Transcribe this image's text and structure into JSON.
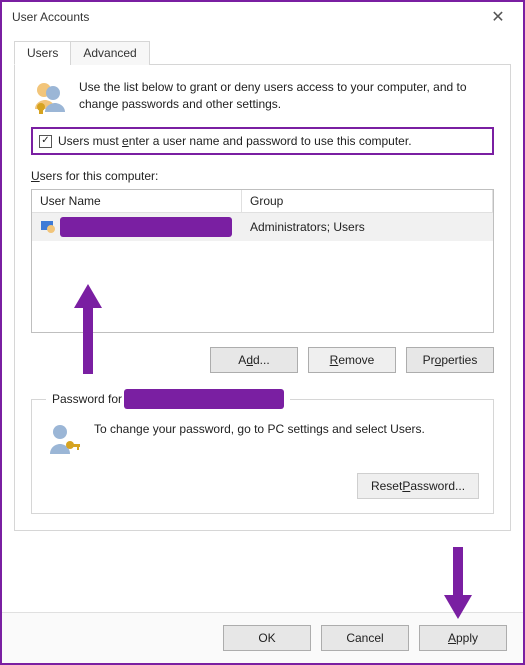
{
  "window": {
    "title": "User Accounts"
  },
  "tabs": {
    "users": "Users",
    "advanced": "Advanced"
  },
  "intro": "Use the list below to grant or deny users access to your computer, and to change passwords and other settings.",
  "checkbox_label_pre": "Users must ",
  "checkbox_label_u": "e",
  "checkbox_label_post": "nter a user name and password to use this computer.",
  "users_label_pre": "",
  "users_label_u": "U",
  "users_label_post": "sers for this computer:",
  "columns": {
    "name": "User Name",
    "group": "Group"
  },
  "row": {
    "group": "Administrators; Users"
  },
  "buttons": {
    "add_pre": "A",
    "add_u": "d",
    "add_post": "d...",
    "remove_pre": "",
    "remove_u": "R",
    "remove_post": "emove",
    "properties_pre": "Pr",
    "properties_u": "o",
    "properties_post": "perties"
  },
  "fieldset_legend": "Password for ",
  "pwd_text": "To change your password, go to PC settings and select Users.",
  "reset_pre": "Reset ",
  "reset_u": "P",
  "reset_post": "assword...",
  "footer": {
    "ok": "OK",
    "cancel": "Cancel",
    "apply_pre": "",
    "apply_u": "A",
    "apply_post": "pply"
  }
}
